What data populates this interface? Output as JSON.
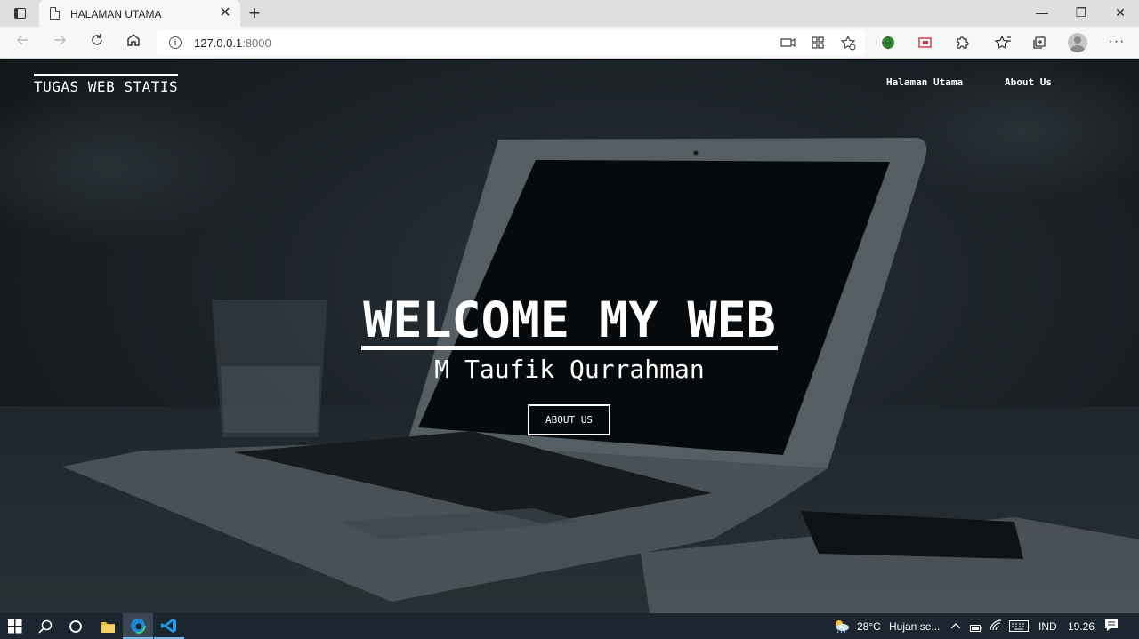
{
  "browser": {
    "tab_title": "HALAMAN UTAMA",
    "tab_close": "✕",
    "new_tab": "+",
    "window_controls": {
      "minimize": "—",
      "restore": "❐",
      "close": "✕"
    },
    "url_host": "127.0.0.1",
    "url_port": ":8000",
    "info_icon": "i",
    "more_label": "···"
  },
  "site": {
    "brand": "TUGAS WEB STATIS",
    "nav": [
      "Halaman Utama",
      "About Us"
    ],
    "hero_title": "WELCOME MY WEB",
    "hero_subtitle": "M Taufik Qurrahman",
    "hero_button": "ABOUT US"
  },
  "taskbar": {
    "temperature": "28°C",
    "weather": "Hujan se...",
    "language": "IND",
    "time": "19.26"
  },
  "colors": {
    "taskbar_bg": "#1b2631",
    "accent": "#76b9ed",
    "hero_text": "#ffffff"
  }
}
